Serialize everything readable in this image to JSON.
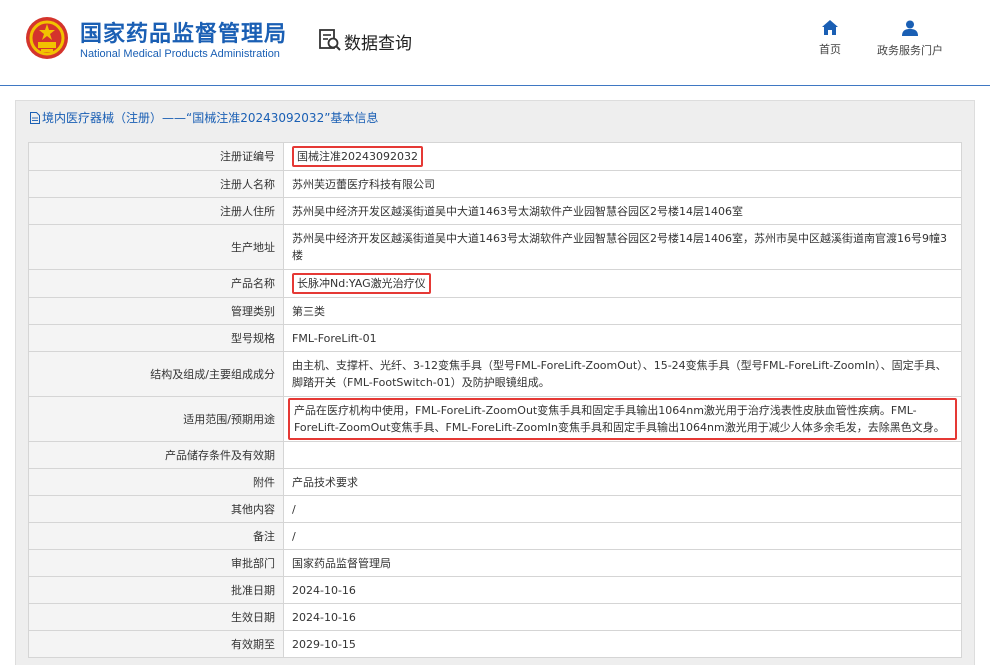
{
  "header": {
    "brand_cn": "国家药品监督管理局",
    "brand_en": "National Medical Products Administration",
    "query_label": "数据查询",
    "nav": [
      {
        "label": "首页",
        "icon": "home-icon"
      },
      {
        "label": "政务服务门户",
        "icon": "user-icon"
      }
    ]
  },
  "panel": {
    "title": "境内医疗器械（注册）——“国械注准20243092032”基本信息"
  },
  "rows": [
    {
      "label": "注册证编号",
      "value": "国械注准20243092032"
    },
    {
      "label": "注册人名称",
      "value": "苏州芙迈蕾医疗科技有限公司"
    },
    {
      "label": "注册人住所",
      "value": "苏州吴中经济开发区越溪街道吴中大道1463号太湖软件产业园智慧谷园区2号楼14层1406室"
    },
    {
      "label": "生产地址",
      "value": "苏州吴中经济开发区越溪街道吴中大道1463号太湖软件产业园智慧谷园区2号楼14层1406室，苏州市吴中区越溪街道南官渡16号9幢3楼"
    },
    {
      "label": "产品名称",
      "value": "长脉冲Nd:YAG激光治疗仪"
    },
    {
      "label": "管理类别",
      "value": "第三类"
    },
    {
      "label": "型号规格",
      "value": "FML-ForeLift-01"
    },
    {
      "label": "结构及组成/主要组成成分",
      "value": "由主机、支撑杆、光纤、3-12变焦手具（型号FML-ForeLift-ZoomOut）、15-24变焦手具（型号FML-ForeLift-ZoomIn）、固定手具、脚踏开关（FML-FootSwitch-01）及防护眼镜组成。"
    },
    {
      "label": "适用范围/预期用途",
      "value": "产品在医疗机构中使用，FML-ForeLift-ZoomOut变焦手具和固定手具输出1064nm激光用于治疗浅表性皮肤血管性疾病。FML-ForeLift-ZoomOut变焦手具、FML-ForeLift-ZoomIn变焦手具和固定手具输出1064nm激光用于减少人体多余毛发，去除黑色文身。"
    },
    {
      "label": "产品储存条件及有效期",
      "value": ""
    },
    {
      "label": "附件",
      "value": "产品技术要求"
    },
    {
      "label": "其他内容",
      "value": "/"
    },
    {
      "label": "备注",
      "value": "/"
    },
    {
      "label": "审批部门",
      "value": "国家药品监督管理局"
    },
    {
      "label": "批准日期",
      "value": "2024-10-16"
    },
    {
      "label": "生效日期",
      "value": "2024-10-16"
    },
    {
      "label": "有效期至",
      "value": "2029-10-15"
    }
  ],
  "colors": {
    "brand_blue": "#1a5fb4",
    "highlight_red": "#e53935"
  }
}
